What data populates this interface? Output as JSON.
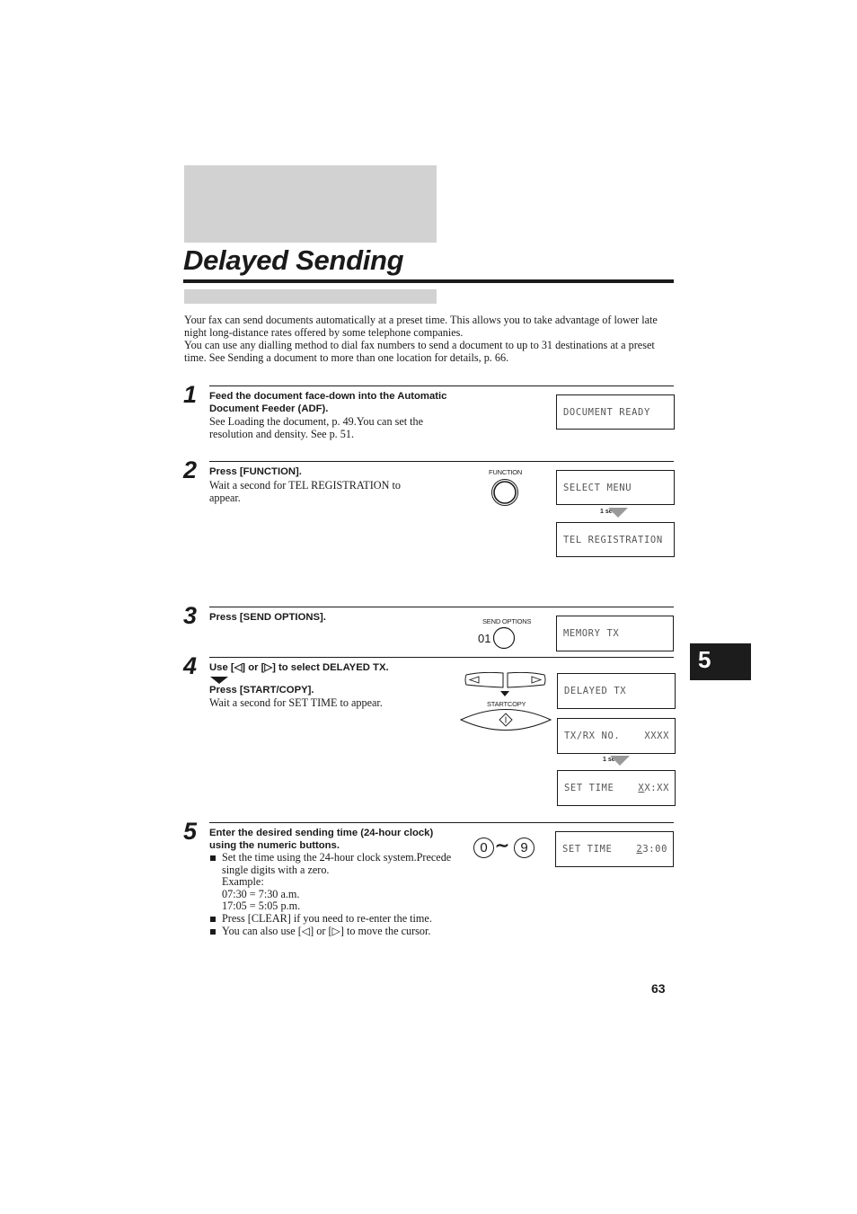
{
  "page": {
    "title": "Delayed Sending",
    "page_number": "63",
    "chapter_tab": "5"
  },
  "intro": [
    "Your fax can send documents automatically at a preset time. This allows you to take advantage of lower late night long-distance rates offered by some telephone companies.",
    "You can use any dialling method to dial fax numbers to send a document to up to 31 destinations at a preset time. See Sending a document to more than one location for details, p. 66."
  ],
  "steps": [
    {
      "number": "1",
      "bold": "Feed the document face-down into the Automatic Document Feeder (ADF).",
      "body": "See Loading the document, p. 49.You can set the resolution and density. See p. 51.",
      "displays": [
        {
          "left": "DOCUMENT READY",
          "right": ""
        }
      ]
    },
    {
      "number": "2",
      "bold": "Press [FUNCTION].",
      "body": "Wait a second for TEL REGISTRATION to appear.",
      "button_label": "FUNCTION",
      "delay_label": "1 sec.",
      "displays": [
        {
          "left": "SELECT MENU",
          "right": ""
        },
        {
          "left": "TEL REGISTRATION",
          "right": ""
        }
      ]
    },
    {
      "number": "3",
      "bold": "Press [SEND OPTIONS].",
      "button_label": "SEND OPTIONS",
      "button_number": "01",
      "displays": [
        {
          "left": "MEMORY TX",
          "right": ""
        }
      ]
    },
    {
      "number": "4",
      "bold": "Use [◁] or [▷] to select DELAYED TX.",
      "bold2": "Press [START/COPY].",
      "body": "Wait a second for SET TIME to appear.",
      "button_label": "STARTCOPY",
      "delay_label": "1 sec.",
      "displays": [
        {
          "left": "DELAYED TX",
          "right": ""
        },
        {
          "left": "TX/RX NO.",
          "right": "XXXX"
        },
        {
          "left": "SET TIME",
          "right_cursor": "X",
          "right_rest": "X:XX"
        }
      ]
    },
    {
      "number": "5",
      "bold": "Enter the desired sending time (24-hour clock) using the numeric buttons.",
      "bullets": [
        {
          "lines": [
            "Set the time using the 24-hour clock system.Precede single digits with a zero.",
            "Example:",
            "07:30 = 7:30 a.m.",
            "17:05 = 5:05 p.m."
          ]
        },
        {
          "lines": [
            "Press [CLEAR] if you need to re-enter the time."
          ]
        },
        {
          "lines": [
            "You can also use [◁] or [▷] to move the cursor."
          ]
        }
      ],
      "keys": {
        "from": "0",
        "to": "9",
        "sep": "∼"
      },
      "displays": [
        {
          "left": "SET TIME",
          "right_cursor": "2",
          "right_rest": "3:00"
        }
      ]
    }
  ]
}
